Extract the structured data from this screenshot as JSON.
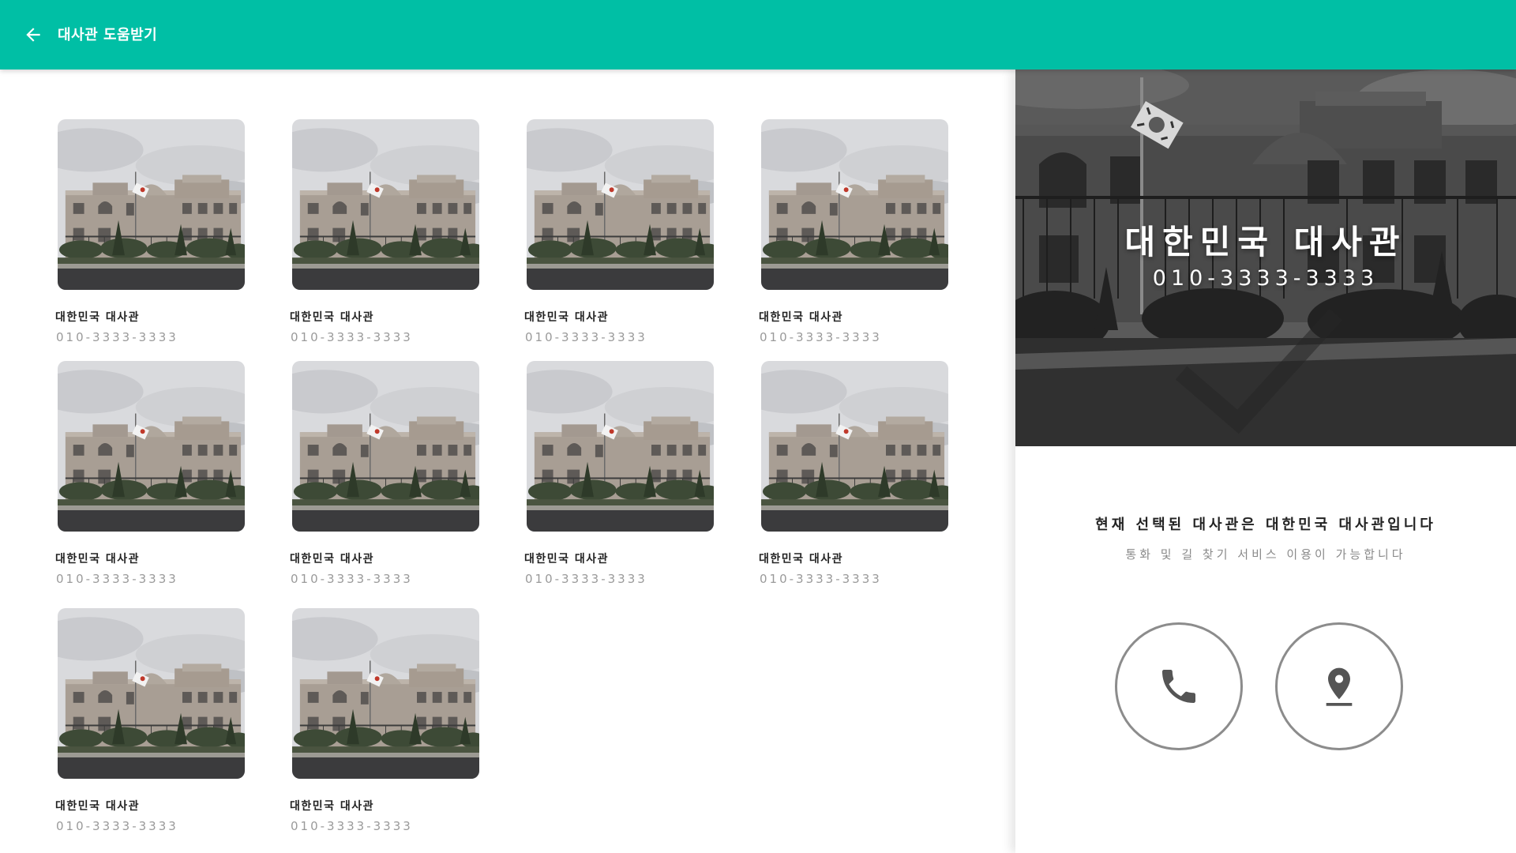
{
  "header": {
    "title": "대사관 도움받기",
    "back_icon": "arrow-left-icon",
    "color": "#00bfa5"
  },
  "embassies": [
    {
      "name": "대한민국 대사관",
      "phone": "010-3333-3333"
    },
    {
      "name": "대한민국 대사관",
      "phone": "010-3333-3333"
    },
    {
      "name": "대한민국 대사관",
      "phone": "010-3333-3333"
    },
    {
      "name": "대한민국 대사관",
      "phone": "010-3333-3333"
    },
    {
      "name": "대한민국 대사관",
      "phone": "010-3333-3333"
    },
    {
      "name": "대한민국 대사관",
      "phone": "010-3333-3333"
    },
    {
      "name": "대한민국 대사관",
      "phone": "010-3333-3333"
    },
    {
      "name": "대한민국 대사관",
      "phone": "010-3333-3333"
    },
    {
      "name": "대한민국 대사관",
      "phone": "010-3333-3333"
    },
    {
      "name": "대한민국 대사관",
      "phone": "010-3333-3333"
    }
  ],
  "detail": {
    "name": "대한민국 대사관",
    "phone": "010-3333-3333",
    "selected_text": "현재 선택된 대사관은 대한민국 대사관입니다",
    "services_text": "통화 및 길 찾기 서비스 이용이 가능합니다",
    "selected_icon": "checkmark-icon",
    "call_icon": "phone-icon",
    "map_icon": "location-pin-icon"
  }
}
